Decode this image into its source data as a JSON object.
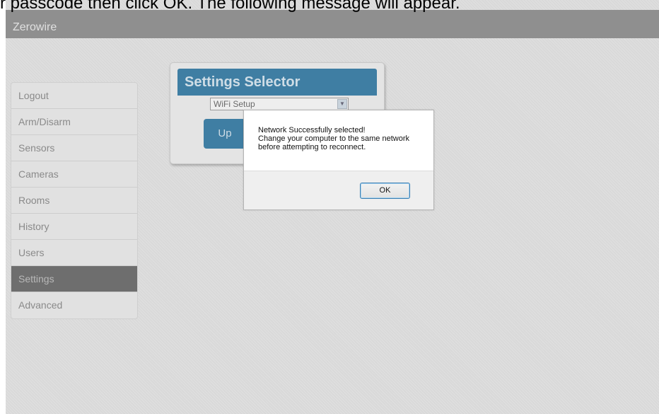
{
  "caption": "r passcode then click OK. The following message will appear.",
  "app": {
    "title": "Zerowire"
  },
  "sidebar": {
    "items": [
      {
        "label": "Logout",
        "active": false
      },
      {
        "label": "Arm/Disarm",
        "active": false
      },
      {
        "label": "Sensors",
        "active": false
      },
      {
        "label": "Cameras",
        "active": false
      },
      {
        "label": "Rooms",
        "active": false
      },
      {
        "label": "History",
        "active": false
      },
      {
        "label": "Users",
        "active": false
      },
      {
        "label": "Settings",
        "active": true
      },
      {
        "label": "Advanced",
        "active": false
      }
    ]
  },
  "settings_selector": {
    "title": "Settings Selector",
    "selected_option": "WiFi Setup",
    "up_button_label": "Up"
  },
  "dialog": {
    "line1": "Network Successfully selected!",
    "line2": "Change your computer to the same network",
    "line3": "before attempting to reconnect.",
    "ok_label": "OK"
  },
  "colors": {
    "accent": "#3f7ea3",
    "active_nav": "#6e6e6e",
    "header_bar": "#8f8f8f"
  }
}
